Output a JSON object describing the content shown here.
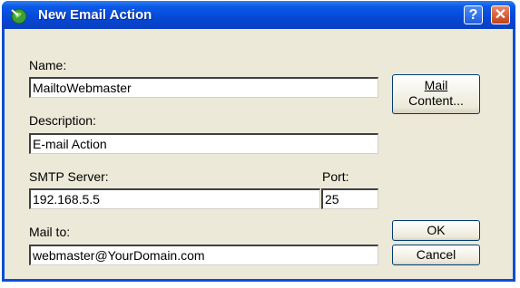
{
  "window": {
    "title": "New Email Action"
  },
  "titlebar": {
    "help_label": "?",
    "close_label": "✕"
  },
  "form": {
    "name_label": "Name:",
    "name_value": "MailtoWebmaster",
    "description_label": "Description:",
    "description_value": "E-mail Action",
    "smtp_label": "SMTP Server:",
    "smtp_value": "192.168.5.5",
    "port_label": "Port:",
    "port_value": "25",
    "mailto_label": "Mail to:",
    "mailto_value": "webmaster@YourDomain.com"
  },
  "buttons": {
    "mail_content_line1": "Mail",
    "mail_content_line2": "Content...",
    "ok": "OK",
    "cancel": "Cancel"
  },
  "icons": {
    "app": "green-globe-icon",
    "help": "question-icon",
    "close": "close-icon"
  },
  "colors": {
    "titlebar": "#0548d6",
    "dialog_bg": "#ece9d8",
    "close": "#c24218"
  }
}
